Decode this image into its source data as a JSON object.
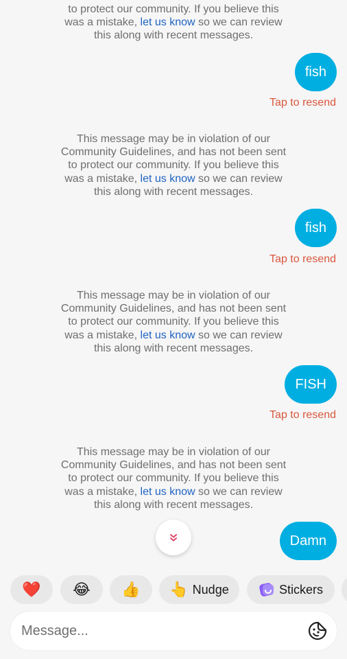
{
  "messages": [
    {
      "notice": {
        "lines": [
          "to protect our community. If you believe this"
        ],
        "line_pre": "was a mistake, ",
        "link": "let us know",
        "line_post": " so we can review",
        "last_line": "this along with recent messages."
      },
      "bubble": "fish",
      "resend": "Tap to resend"
    },
    {
      "notice": {
        "lines": [
          "This message may be in violation of our",
          "Community Guidelines, and has not been sent",
          "to protect our community. If you believe this"
        ],
        "line_pre": "was a mistake, ",
        "link": "let us know",
        "line_post": " so we can review",
        "last_line": "this along with recent messages."
      },
      "bubble": "fish",
      "resend": "Tap to resend"
    },
    {
      "notice": {
        "lines": [
          "This message may be in violation of our",
          "Community Guidelines, and has not been sent",
          "to protect our community. If you believe this"
        ],
        "line_pre": "was a mistake, ",
        "link": "let us know",
        "line_post": " so we can review",
        "last_line": "this along with recent messages."
      },
      "bubble": "FISH",
      "resend": "Tap to resend"
    },
    {
      "notice": {
        "lines": [
          "This message may be in violation of our",
          "Community Guidelines, and has not been sent",
          "to protect our community. If you believe this"
        ],
        "line_pre": "was a mistake, ",
        "link": "let us know",
        "line_post": " so we can review",
        "last_line": "this along with recent messages."
      },
      "bubble": "Damn"
    }
  ],
  "reactions": [
    {
      "emoji": "❤️",
      "icon": "heart-icon"
    },
    {
      "emoji": "😂",
      "icon": "laughing-face-icon"
    },
    {
      "emoji": "👍",
      "icon": "thumbs-up-icon"
    },
    {
      "emoji": "👆",
      "label": "Nudge",
      "icon": "pointing-hand-icon"
    },
    {
      "label": "Stickers",
      "icon": "sticker-icon"
    }
  ],
  "composer": {
    "placeholder": "Message..."
  },
  "colors": {
    "bubble": "#00aee1",
    "resend": "#d9573d",
    "link": "#1f63c2",
    "background": "#f6f6f6"
  }
}
